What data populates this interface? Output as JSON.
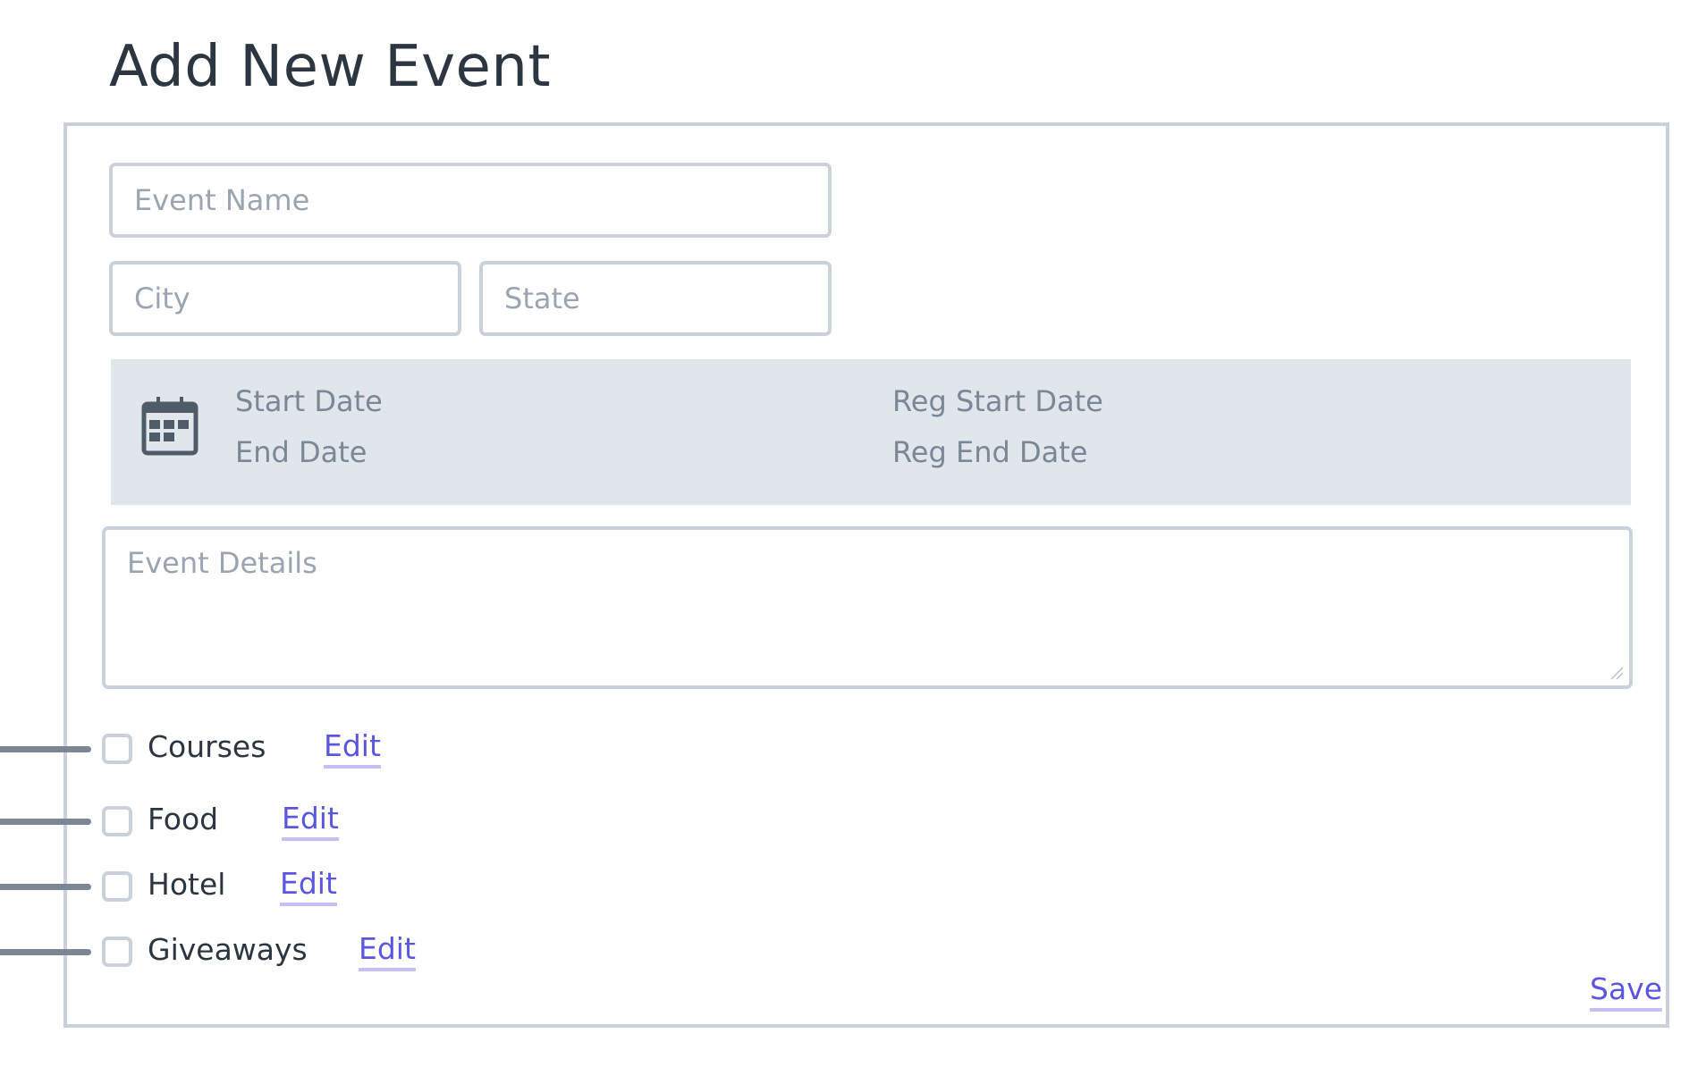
{
  "page": {
    "title": "Add New Event"
  },
  "form": {
    "event_name": {
      "value": "",
      "placeholder": "Event Name"
    },
    "city": {
      "value": "",
      "placeholder": "City"
    },
    "state": {
      "value": "",
      "placeholder": "State"
    },
    "dates": {
      "icon": "calendar-icon",
      "start_date_label": "Start Date",
      "end_date_label": "End Date",
      "reg_start_date_label": "Reg Start Date",
      "reg_end_date_label": "Reg End Date"
    },
    "event_details": {
      "value": "",
      "placeholder": "Event Details"
    },
    "options": [
      {
        "label": "Courses",
        "checked": false,
        "edit_label": "Edit"
      },
      {
        "label": "Food",
        "checked": false,
        "edit_label": "Edit"
      },
      {
        "label": "Hotel",
        "checked": false,
        "edit_label": "Edit"
      },
      {
        "label": "Giveaways",
        "checked": false,
        "edit_label": "Edit"
      }
    ],
    "save_label": "Save"
  },
  "colors": {
    "title_text": "#2b3641",
    "border": "#c9d2da",
    "placeholder": "#9aa5b1",
    "date_panel_bg": "#e0e6ec",
    "date_label": "#7b8794",
    "icon": "#4f5b67",
    "link": "#5a56e0",
    "link_underline": "#c4c2f5",
    "connector": "#7b8794"
  }
}
